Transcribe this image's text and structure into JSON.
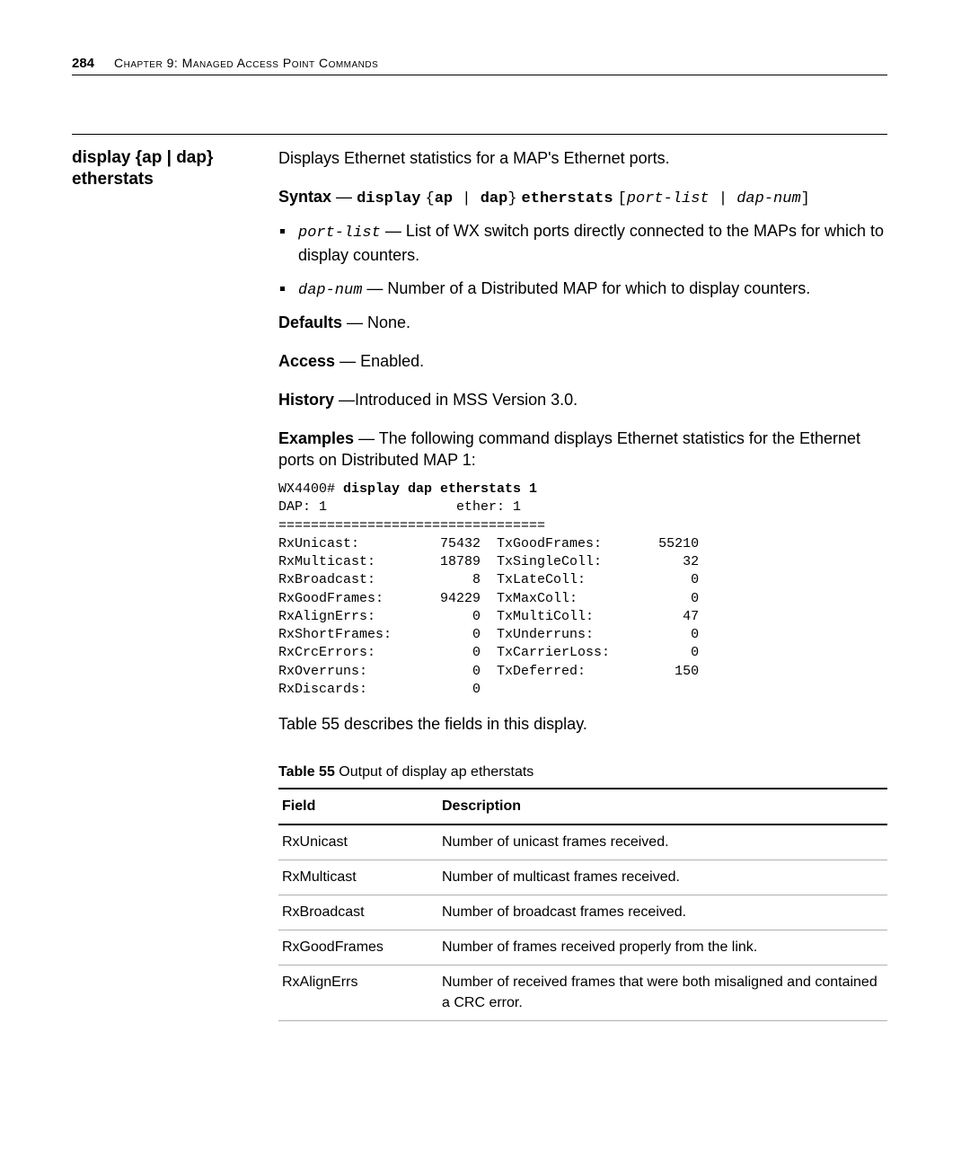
{
  "header": {
    "page_number": "284",
    "chapter": "Chapter 9: Managed Access Point Commands"
  },
  "sidebar": {
    "command_title_l1": "display {ap | dap}",
    "command_title_l2": "etherstats"
  },
  "description": "Displays Ethernet statistics for a MAP's Ethernet ports.",
  "syntax": {
    "label": "Syntax",
    "prefix": "display",
    "brace_open": "{",
    "ap": "ap",
    "pipe": " | ",
    "dap": "dap",
    "brace_close": "}",
    "cmd2": "etherstats",
    "bracket_open": "[",
    "arg1": "port-list",
    "arg2": "dap-num",
    "bracket_close": "]"
  },
  "bullets": [
    {
      "code": "port-list",
      "text": " — List of WX switch ports directly connected to the MAPs for which to display counters."
    },
    {
      "code": "dap-num",
      "text": " — Number of a Distributed MAP for which to display counters."
    }
  ],
  "defaults": {
    "label": "Defaults",
    "value": " — None."
  },
  "access": {
    "label": "Access",
    "value": " — Enabled."
  },
  "history": {
    "label": "History",
    "value": " —Introduced in MSS Version 3.0."
  },
  "examples": {
    "label": "Examples",
    "text": " — The following command displays Ethernet statistics for the Ethernet ports on Distributed MAP 1:"
  },
  "terminal": {
    "prompt": "WX4400# ",
    "command": "display dap etherstats 1",
    "header_line": "DAP: 1                ether: 1",
    "sep": "=================================",
    "rows": [
      [
        "RxUnicast:",
        "75432",
        "TxGoodFrames:",
        "55210"
      ],
      [
        "RxMulticast:",
        "18789",
        "TxSingleColl:",
        "32"
      ],
      [
        "RxBroadcast:",
        "8",
        "TxLateColl:",
        "0"
      ],
      [
        "RxGoodFrames:",
        "94229",
        "TxMaxColl:",
        "0"
      ],
      [
        "RxAlignErrs:",
        "0",
        "TxMultiColl:",
        "47"
      ],
      [
        "RxShortFrames:",
        "0",
        "TxUnderruns:",
        "0"
      ],
      [
        "RxCrcErrors:",
        "0",
        "TxCarrierLoss:",
        "0"
      ],
      [
        "RxOverruns:",
        "0",
        "TxDeferred:",
        "150"
      ],
      [
        "RxDiscards:",
        "0",
        "",
        ""
      ]
    ]
  },
  "note": "Table 55 describes the fields in this display.",
  "table": {
    "title_bold": "Table 55",
    "title_rest": "   Output of display ap etherstats",
    "cols": [
      "Field",
      "Description"
    ],
    "rows": [
      [
        "RxUnicast",
        "Number of unicast frames received."
      ],
      [
        "RxMulticast",
        "Number of multicast frames received."
      ],
      [
        "RxBroadcast",
        "Number of broadcast frames received."
      ],
      [
        "RxGoodFrames",
        "Number of frames received properly from the link."
      ],
      [
        "RxAlignErrs",
        "Number of received frames that were both misaligned and contained a CRC error."
      ]
    ]
  }
}
